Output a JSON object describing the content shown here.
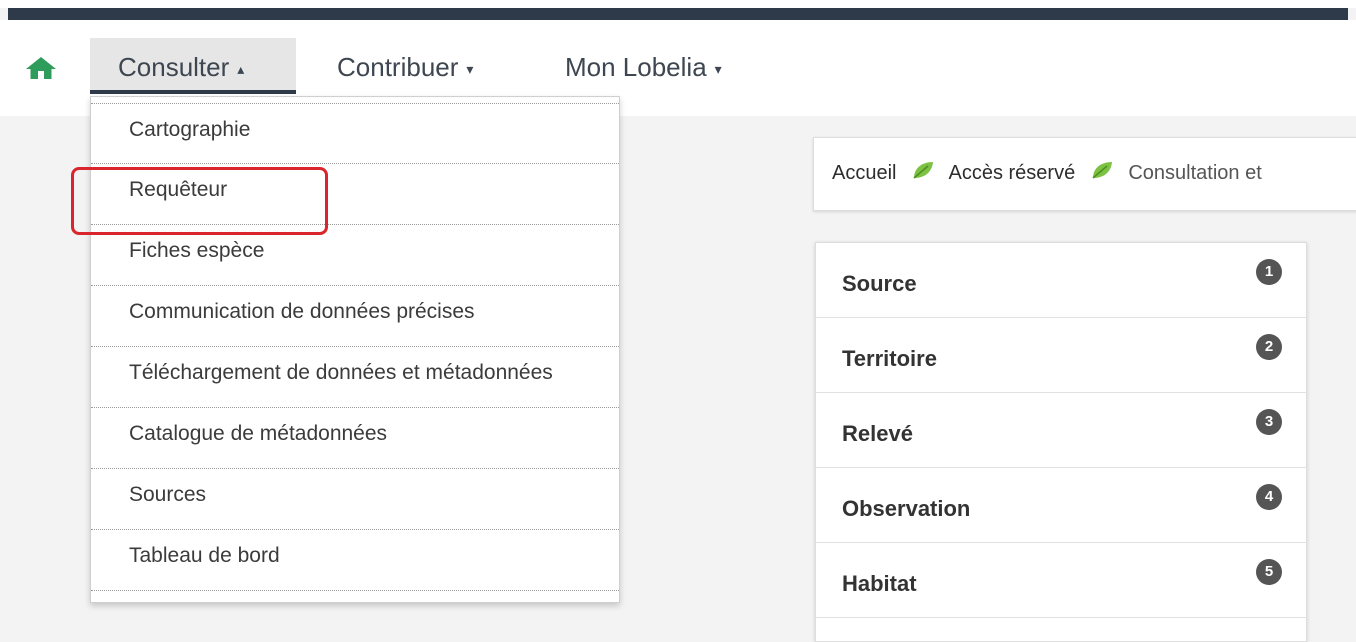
{
  "nav": {
    "home_icon": "home-icon",
    "items": [
      {
        "label": "Consulter",
        "caret": "▴"
      },
      {
        "label": "Contribuer",
        "caret": "▾"
      },
      {
        "label": "Mon Lobelia",
        "caret": "▾"
      }
    ]
  },
  "dropdown": {
    "items": [
      "Cartographie",
      "Requêteur",
      "Fiches espèce",
      "Communication de données précises",
      "Téléchargement de données et métadonnées",
      "Catalogue de métadonnées",
      "Sources",
      "Tableau de bord"
    ]
  },
  "breadcrumb": {
    "items": [
      "Accueil",
      "Accès réservé",
      "Consultation et"
    ],
    "separator_icon": "leaf-icon"
  },
  "steps": [
    {
      "label": "Source",
      "number": "1"
    },
    {
      "label": "Territoire",
      "number": "2"
    },
    {
      "label": "Relevé",
      "number": "3"
    },
    {
      "label": "Observation",
      "number": "4"
    },
    {
      "label": "Habitat",
      "number": "5"
    }
  ],
  "colors": {
    "accent_green": "#2e9c5a",
    "topbar_dark": "#2e3a49",
    "highlight_red": "#d9262c"
  }
}
